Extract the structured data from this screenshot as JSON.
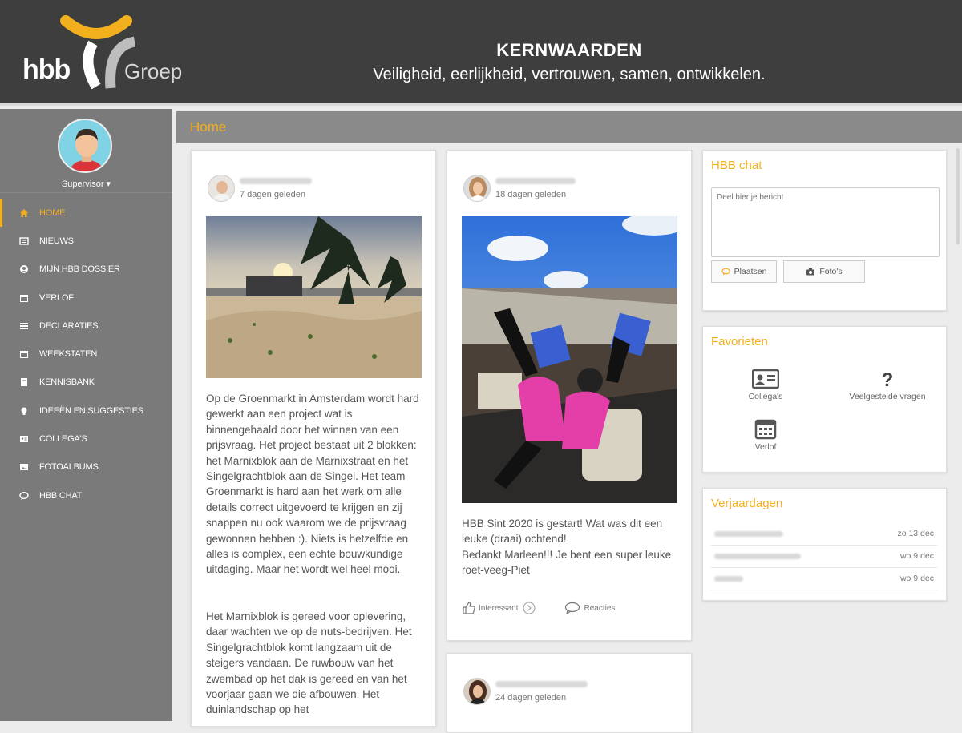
{
  "header": {
    "logo_text": "hbb",
    "logo_sub": "Groep",
    "title": "KERNWAARDEN",
    "subtitle": "Veiligheid, eerlijkheid, vertrouwen, samen, ontwikkelen."
  },
  "sidebar": {
    "user_role": "Supervisor ▾",
    "items": [
      {
        "label": "HOME",
        "icon": "home-icon"
      },
      {
        "label": "NIEUWS",
        "icon": "news-icon"
      },
      {
        "label": "MIJN HBB DOSSIER",
        "icon": "user-icon"
      },
      {
        "label": "VERLOF",
        "icon": "calendar-icon"
      },
      {
        "label": "DECLARATIES",
        "icon": "list-icon"
      },
      {
        "label": "WEEKSTATEN",
        "icon": "calendar-icon"
      },
      {
        "label": "KENNISBANK",
        "icon": "book-icon"
      },
      {
        "label": "IDEEËN EN SUGGESTIES",
        "icon": "lightbulb-icon"
      },
      {
        "label": "COLLEGA'S",
        "icon": "contacts-icon"
      },
      {
        "label": "FOTOALBUMS",
        "icon": "image-icon"
      },
      {
        "label": "HBB CHAT",
        "icon": "chat-icon"
      }
    ]
  },
  "breadcrumb": "Home",
  "posts": [
    {
      "time": "7 dagen geleden",
      "text": "Op de Groenmarkt in Amsterdam wordt hard gewerkt aan een project wat is binnengehaald door het winnen van een prijsvraag. Het project bestaat uit 2 blokken: het Marnixblok aan de Marnixstraat en het Singelgrachtblok aan de Singel. Het team Groenmarkt is hard aan het werk om alle details correct uitgevoerd te krijgen en zij snappen nu ook waarom we de prijsvraag gewonnen hebben :). Niets is hetzelfde en alles is complex, een echte bouwkundige uitdaging. Maar het wordt wel heel mooi.",
      "text2": "Het Marnixblok is gereed voor oplevering, daar wachten we op de nuts-bedrijven. Het Singelgrachtblok komt langzaam uit de steigers vandaan. De ruwbouw van het zwembad op het dak is gereed en van het voorjaar gaan we die afbouwen. Het duinlandschap op het"
    },
    {
      "time": "18 dagen geleden",
      "text": "HBB Sint 2020 is gestart! Wat was dit een leuke (draai) ochtend!",
      "text2": "Bedankt Marleen!!! Je bent een super leuke roet-veeg-Piet",
      "like_label": "Interessant",
      "react_label": "Reacties"
    },
    {
      "time": "24 dagen geleden"
    }
  ],
  "chat": {
    "title": "HBB chat",
    "placeholder": "Deel hier je bericht",
    "post_label": "Plaatsen",
    "photo_label": "Foto's"
  },
  "favorites": {
    "title": "Favorieten",
    "items": [
      {
        "label": "Collega's",
        "icon": "id-card-icon"
      },
      {
        "label": "Veelgestelde vragen",
        "icon": "question-icon"
      },
      {
        "label": "Verlof",
        "icon": "calendar-icon"
      }
    ]
  },
  "birthdays": {
    "title": "Verjaardagen",
    "items": [
      {
        "date": "zo 13 dec"
      },
      {
        "date": "wo 9 dec"
      },
      {
        "date": "wo 9 dec"
      }
    ]
  },
  "colors": {
    "accent": "#f2b01e",
    "header_bg": "#3e3e3e",
    "sidebar_bg": "#7a7a7a"
  }
}
